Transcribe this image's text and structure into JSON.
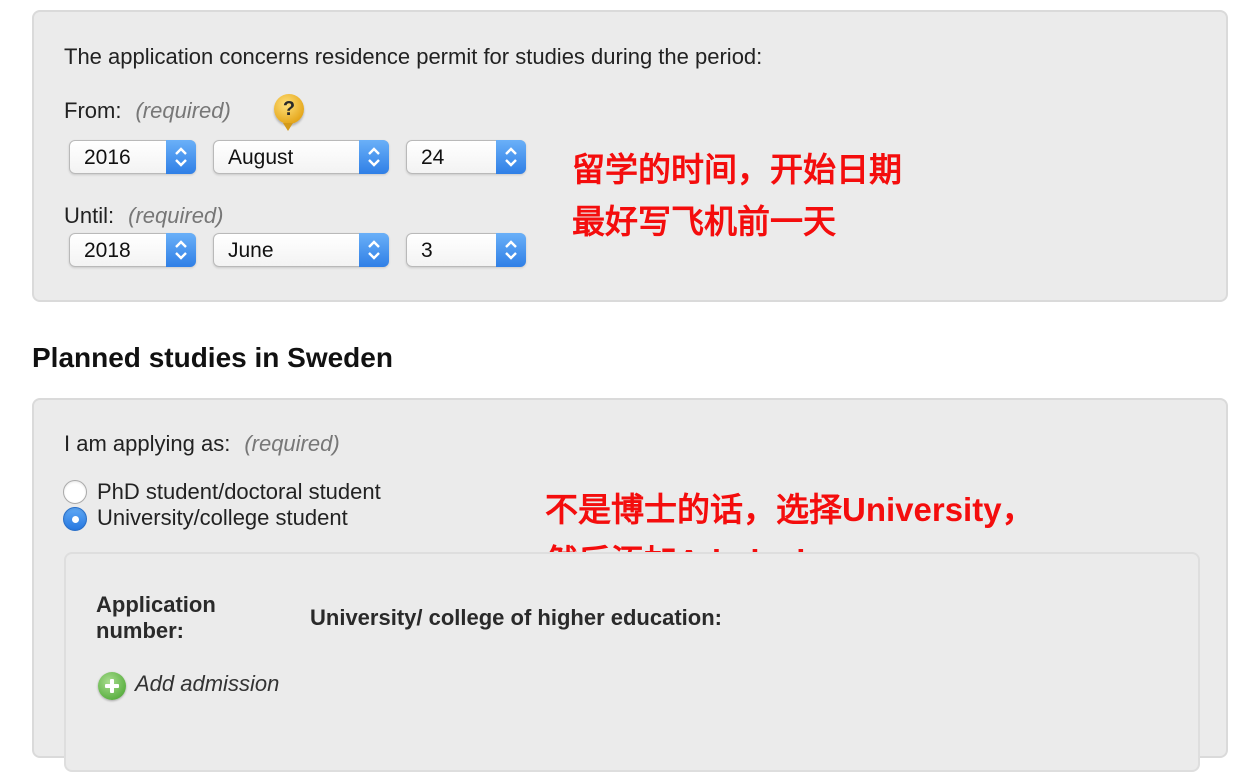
{
  "period": {
    "intro": "The application concerns residence permit for studies during the period:",
    "from_label": "From:",
    "until_label": "Until:",
    "required_text": "(required)",
    "help_symbol": "?",
    "from": {
      "year": "2016",
      "month": "August",
      "day": "24"
    },
    "until": {
      "year": "2018",
      "month": "June",
      "day": "3"
    }
  },
  "annotations": {
    "period_line1": "留学的时间，开始日期",
    "period_line2": "最好写飞机前一天",
    "studies_line1": "不是博士的话，选择University，",
    "studies_line2": "然后添加Admission"
  },
  "studies": {
    "heading": "Planned studies in Sweden",
    "applying_as_label": "I am applying as:",
    "required_text": "(required)",
    "options": [
      {
        "label": "PhD student/doctoral student",
        "checked": false
      },
      {
        "label": "University/college student",
        "checked": true
      }
    ],
    "table": {
      "col_application_line1": "Application",
      "col_application_line2": "number:",
      "col_university": "University/ college of higher education:"
    },
    "add_admission": "Add admission"
  },
  "colors": {
    "annotation": "#f40d0d",
    "panel_bg": "#ebebeb",
    "select_arrow": "#2f7fe6",
    "add_icon": "#5fb246",
    "help_icon": "#e6a91f"
  },
  "icons": [
    "help-icon",
    "add-icon",
    "select-arrows-icon"
  ]
}
